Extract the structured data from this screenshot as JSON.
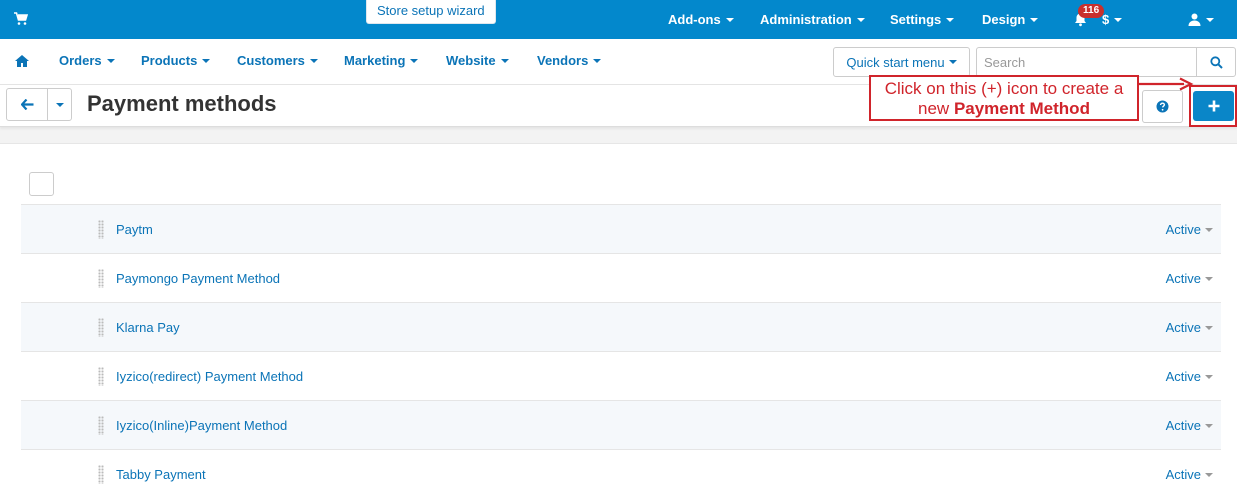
{
  "topbar": {
    "wizard_label": "Store setup wizard",
    "menus": [
      {
        "label": "Add-ons"
      },
      {
        "label": "Administration"
      },
      {
        "label": "Settings"
      },
      {
        "label": "Design"
      }
    ],
    "notification_count": "116",
    "currency_label": "$"
  },
  "subnav": {
    "items": [
      {
        "label": "Orders"
      },
      {
        "label": "Products"
      },
      {
        "label": "Customers"
      },
      {
        "label": "Marketing"
      },
      {
        "label": "Website"
      },
      {
        "label": "Vendors"
      }
    ],
    "quick_start_label": "Quick start menu",
    "search_placeholder": "Search"
  },
  "titlebar": {
    "title": "Payment methods"
  },
  "annotation": {
    "line1": "Click on this (+) icon to create a",
    "line2_prefix": "new ",
    "line2_bold": "Payment Method",
    "color": "#d0242b"
  },
  "payment_methods": [
    {
      "name": "Paytm",
      "status": "Active"
    },
    {
      "name": "Paymongo Payment Method",
      "status": "Active"
    },
    {
      "name": "Klarna Pay",
      "status": "Active"
    },
    {
      "name": "Iyzico(redirect) Payment Method",
      "status": "Active"
    },
    {
      "name": "Iyzico(Inline)Payment Method",
      "status": "Active"
    },
    {
      "name": "Tabby Payment",
      "status": "Active"
    }
  ],
  "colors": {
    "topbar": "#0388cc",
    "link": "#0b74b7",
    "primary_button": "#0a86c8",
    "badge": "#c9302c"
  }
}
